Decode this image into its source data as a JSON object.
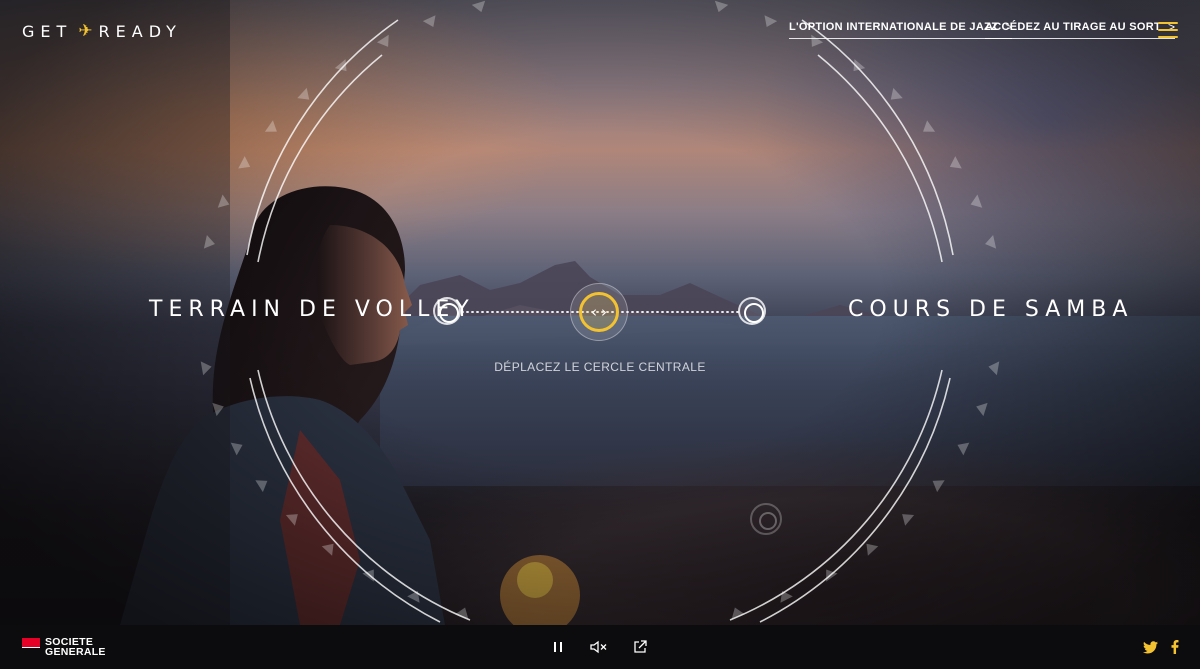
{
  "header": {
    "logo_left": "GET",
    "logo_right": "READY",
    "links": [
      {
        "label": "L'OPTION INTERNATIONALE DE JAZZ",
        "chevron": ">"
      },
      {
        "label": "ACCÉDEZ AU TIRAGE AU SORT",
        "chevron": ">"
      }
    ],
    "menu_icon": "hamburger-icon",
    "accent_color": "#f2c230"
  },
  "selector": {
    "left_option": "TERRAIN DE VOLLEY",
    "right_option": "COURS DE SAMBA",
    "hint": "DÉPLACEZ LE CERCLE CENTRALE",
    "handle_icon": "left-right-arrows-icon"
  },
  "footer": {
    "brand_line1": "SOCIETE",
    "brand_line2": "GENERALE",
    "brand_color": "#e60028",
    "controls": [
      "pause-icon",
      "mute-icon",
      "share-icon"
    ],
    "social": [
      "twitter-icon",
      "facebook-icon"
    ]
  }
}
